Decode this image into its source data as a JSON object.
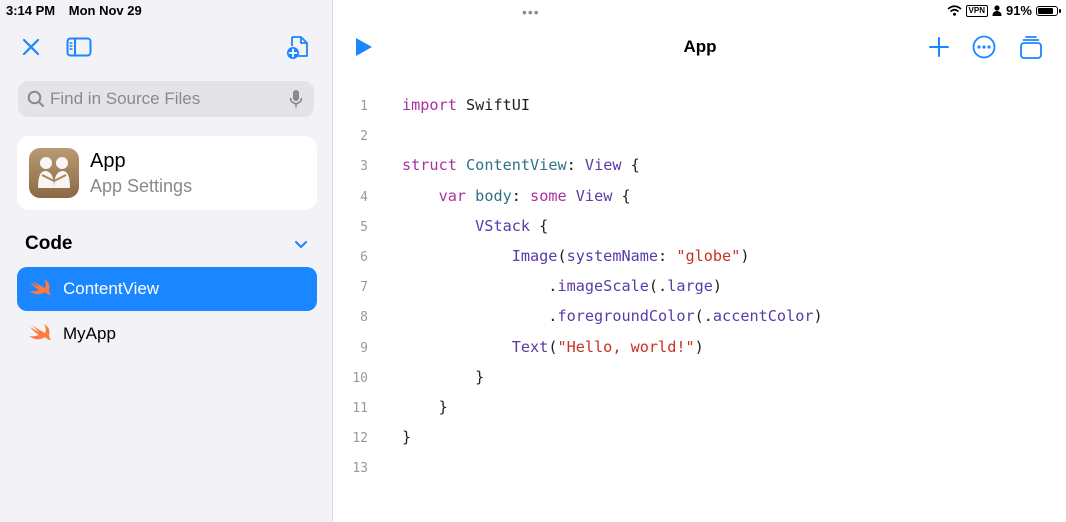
{
  "status_bar": {
    "time": "3:14 PM",
    "date": "Mon Nov 29",
    "vpn": "VPN",
    "battery": "91%",
    "battery_level": 0.91
  },
  "sidebar": {
    "search": {
      "placeholder": "Find in Source Files",
      "value": ""
    },
    "app_card": {
      "name": "App",
      "subtitle": "App Settings"
    },
    "section_title": "Code",
    "files": [
      {
        "label": "ContentView",
        "selected": true
      },
      {
        "label": "MyApp",
        "selected": false
      }
    ]
  },
  "editor": {
    "title": "App",
    "line_numbers": [
      "1",
      "2",
      "3",
      "4",
      "5",
      "6",
      "7",
      "8",
      "9",
      "10",
      "11",
      "12",
      "13"
    ],
    "lines": [
      [
        {
          "t": "import",
          "c": "kw"
        },
        {
          "t": " SwiftUI",
          "c": ""
        }
      ],
      [],
      [
        {
          "t": "struct",
          "c": "kw"
        },
        {
          "t": " ",
          "c": ""
        },
        {
          "t": "ContentView",
          "c": "mb"
        },
        {
          "t": ": ",
          "c": ""
        },
        {
          "t": "View",
          "c": "ty"
        },
        {
          "t": " {",
          "c": ""
        }
      ],
      [
        {
          "t": "    ",
          "c": ""
        },
        {
          "t": "var",
          "c": "kw"
        },
        {
          "t": " ",
          "c": ""
        },
        {
          "t": "body",
          "c": "mb"
        },
        {
          "t": ": ",
          "c": ""
        },
        {
          "t": "some",
          "c": "kw"
        },
        {
          "t": " ",
          "c": ""
        },
        {
          "t": "View",
          "c": "ty"
        },
        {
          "t": " {",
          "c": ""
        }
      ],
      [
        {
          "t": "        ",
          "c": ""
        },
        {
          "t": "VStack",
          "c": "ty"
        },
        {
          "t": " {",
          "c": ""
        }
      ],
      [
        {
          "t": "            ",
          "c": ""
        },
        {
          "t": "Image",
          "c": "ty"
        },
        {
          "t": "(",
          "c": ""
        },
        {
          "t": "systemName",
          "c": "ty"
        },
        {
          "t": ": ",
          "c": ""
        },
        {
          "t": "\"globe\"",
          "c": "st"
        },
        {
          "t": ")",
          "c": ""
        }
      ],
      [
        {
          "t": "                .",
          "c": ""
        },
        {
          "t": "imageScale",
          "c": "ty"
        },
        {
          "t": "(.",
          "c": ""
        },
        {
          "t": "large",
          "c": "ty"
        },
        {
          "t": ")",
          "c": ""
        }
      ],
      [
        {
          "t": "                .",
          "c": ""
        },
        {
          "t": "foregroundColor",
          "c": "ty"
        },
        {
          "t": "(.",
          "c": ""
        },
        {
          "t": "accentColor",
          "c": "ty"
        },
        {
          "t": ")",
          "c": ""
        }
      ],
      [
        {
          "t": "            ",
          "c": ""
        },
        {
          "t": "Text",
          "c": "ty"
        },
        {
          "t": "(",
          "c": ""
        },
        {
          "t": "\"Hello, world!\"",
          "c": "st"
        },
        {
          "t": ")",
          "c": ""
        }
      ],
      [
        {
          "t": "        }",
          "c": ""
        }
      ],
      [
        {
          "t": "    }",
          "c": ""
        }
      ],
      [
        {
          "t": "}",
          "c": ""
        }
      ],
      []
    ]
  },
  "colors": {
    "accent": "#1a86ff",
    "keyword": "#a8329e",
    "type": "#5a3aa8",
    "declaration": "#2f7186",
    "string": "#c8321f"
  }
}
